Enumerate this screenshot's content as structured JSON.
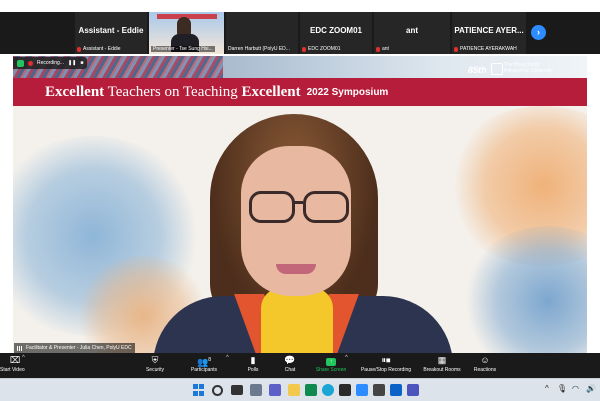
{
  "participants": [
    {
      "name": "Assistant - Eddie",
      "label": "Assistant - Eddie",
      "muted": true
    },
    {
      "name": "",
      "label": "Presenter - Tse Sung Hsi...",
      "muted": false,
      "video": true
    },
    {
      "name": "",
      "label": "Darren Harbutt (PolyU ED...",
      "muted": false
    },
    {
      "name": "EDC ZOOM01",
      "label": "EDC ZOOM01",
      "muted": true
    },
    {
      "name": "ant",
      "label": "ant",
      "muted": true
    },
    {
      "name": "PATIENCE AYER...",
      "label": "PATIENCE AYERAKWAH",
      "muted": true
    }
  ],
  "next_page_glyph": "›",
  "share": {
    "recording_text": "Recording...",
    "anniversary": "85th",
    "university_name_line1": "The Hong Kong",
    "university_name_line2": "Polytechnic University",
    "banner": {
      "excellent1": "Excellent",
      "teachers": " Teachers on Teaching ",
      "excellent2": "Excellent",
      "year": "2022 Symposium"
    },
    "presenter_label": "Facilitator & Presenter - Julia Chen, PolyU EDC"
  },
  "toolbar": {
    "start_video": "Start Video",
    "security": "Security",
    "participants": "Participants",
    "participant_count": "8",
    "polls": "Polls",
    "chat": "Chat",
    "share_screen": "Share Screen",
    "recording": "Pause/Stop Recording",
    "breakout": "Breakout Rooms",
    "reactions": "Reactions"
  },
  "colors": {
    "banner_red": "#b51d3a",
    "zoom_blue": "#2d8cff",
    "share_green": "#22c55e",
    "toolbar_bg": "#1a1a1a"
  }
}
